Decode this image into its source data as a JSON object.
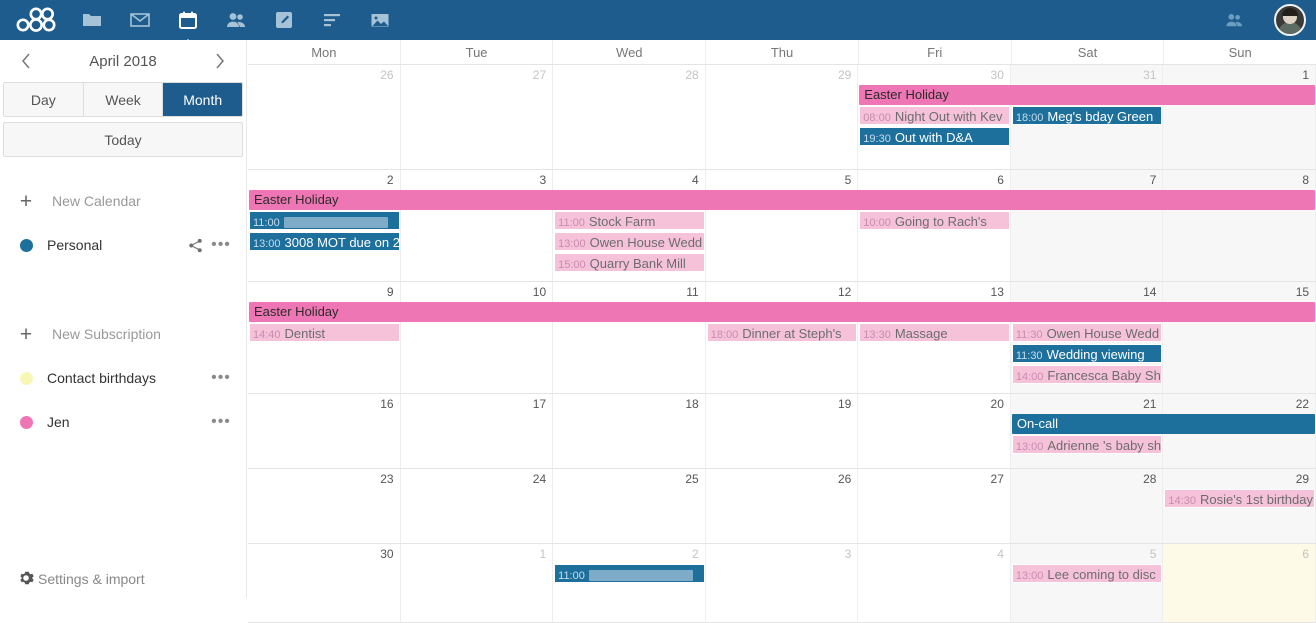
{
  "app": {
    "accent_blue": "#1d5c8c",
    "event_blue": "#1d6f9c",
    "event_pink": "#f5c2da",
    "holiday_pink": "#ee76b4"
  },
  "topbar": {
    "logo_name": "nextcloud-logo",
    "nav": [
      {
        "name": "files-icon",
        "label": "Files"
      },
      {
        "name": "mail-icon",
        "label": "Mail"
      },
      {
        "name": "calendar-icon",
        "label": "Calendar",
        "active": true
      },
      {
        "name": "contacts-icon",
        "label": "Contacts"
      },
      {
        "name": "notes-icon",
        "label": "Notes"
      },
      {
        "name": "tasks-icon",
        "label": "Tasks"
      },
      {
        "name": "photos-icon",
        "label": "Photos"
      }
    ],
    "right": [
      {
        "name": "contacts-menu-icon",
        "label": "Contacts"
      },
      {
        "name": "user-avatar",
        "label": "Account"
      }
    ]
  },
  "sidebar": {
    "month_label": "April 2018",
    "prev_label": "‹",
    "next_label": "›",
    "views": [
      {
        "label": "Day",
        "active": false
      },
      {
        "label": "Week",
        "active": false
      },
      {
        "label": "Month",
        "active": true
      }
    ],
    "today_label": "Today",
    "new_calendar_label": "New Calendar",
    "new_subscription_label": "New Subscription",
    "plus_glyph": "+",
    "dots_glyph": "•••",
    "calendars": [
      {
        "label": "Personal",
        "color": "#1d6f9c",
        "has_share": true,
        "has_menu": true
      },
      {
        "label": "Contact birthdays",
        "color": "#f7f7b6",
        "has_share": false,
        "has_menu": true
      },
      {
        "label": "Jen",
        "color": "#ee76b4",
        "has_share": false,
        "has_menu": true
      }
    ],
    "settings_label": "Settings & import"
  },
  "calendar": {
    "daynames": [
      "Mon",
      "Tue",
      "Wed",
      "Thu",
      "Fri",
      "Sat",
      "Sun"
    ],
    "weeks": [
      {
        "days": [
          {
            "num": "26",
            "other": true,
            "weekend": false
          },
          {
            "num": "27",
            "other": true,
            "weekend": false
          },
          {
            "num": "28",
            "other": true,
            "weekend": false
          },
          {
            "num": "29",
            "other": true,
            "weekend": false
          },
          {
            "num": "30",
            "other": true,
            "weekend": false
          },
          {
            "num": "31",
            "other": true,
            "weekend": true
          },
          {
            "num": "1",
            "other": false,
            "weekend": true
          }
        ],
        "events": [
          {
            "title": "Easter Holiday",
            "time": "",
            "kind": "holiday",
            "start": 4,
            "span": 3,
            "row": 0
          },
          {
            "title": "Night Out with Kev",
            "time": "08:00",
            "kind": "pink",
            "start": 4,
            "span": 1,
            "row": 1
          },
          {
            "title": "Meg's bday Green",
            "time": "18:00",
            "kind": "blue",
            "start": 5,
            "span": 1,
            "row": 1
          },
          {
            "title": "Out with D&A",
            "time": "19:30",
            "kind": "blue",
            "start": 4,
            "span": 1,
            "row": 2
          }
        ]
      },
      {
        "days": [
          {
            "num": "2",
            "other": false,
            "weekend": false
          },
          {
            "num": "3",
            "other": false,
            "weekend": false
          },
          {
            "num": "4",
            "other": false,
            "weekend": false
          },
          {
            "num": "5",
            "other": false,
            "weekend": false
          },
          {
            "num": "6",
            "other": false,
            "weekend": false
          },
          {
            "num": "7",
            "other": false,
            "weekend": true
          },
          {
            "num": "8",
            "other": false,
            "weekend": true
          }
        ],
        "events": [
          {
            "title": "Easter Holiday",
            "time": "",
            "kind": "holiday",
            "start": 0,
            "span": 7,
            "row": 0
          },
          {
            "title": "",
            "time": "11:00",
            "kind": "blue",
            "start": 0,
            "span": 1,
            "row": 1,
            "redacted": true
          },
          {
            "title": "Stock Farm",
            "time": "11:00",
            "kind": "pink",
            "start": 2,
            "span": 1,
            "row": 1
          },
          {
            "title": "3008 MOT due on 2",
            "time": "13:00",
            "kind": "blue",
            "start": 0,
            "span": 1,
            "row": 2
          },
          {
            "title": "Owen House Wedd",
            "time": "13:00",
            "kind": "pink",
            "start": 2,
            "span": 1,
            "row": 2
          },
          {
            "title": "Going to Rach's",
            "time": "10:00",
            "kind": "pink",
            "start": 4,
            "span": 1,
            "row": 1
          },
          {
            "title": "Quarry Bank Mill",
            "time": "15:00",
            "kind": "pink",
            "start": 2,
            "span": 1,
            "row": 3
          }
        ]
      },
      {
        "days": [
          {
            "num": "9",
            "other": false,
            "weekend": false
          },
          {
            "num": "10",
            "other": false,
            "weekend": false
          },
          {
            "num": "11",
            "other": false,
            "weekend": false
          },
          {
            "num": "12",
            "other": false,
            "weekend": false
          },
          {
            "num": "13",
            "other": false,
            "weekend": false
          },
          {
            "num": "14",
            "other": false,
            "weekend": true
          },
          {
            "num": "15",
            "other": false,
            "weekend": true
          }
        ],
        "events": [
          {
            "title": "Easter Holiday",
            "time": "",
            "kind": "holiday",
            "start": 0,
            "span": 7,
            "row": 0
          },
          {
            "title": "Dentist",
            "time": "14:40",
            "kind": "pink",
            "start": 0,
            "span": 1,
            "row": 1
          },
          {
            "title": "Dinner at Steph's",
            "time": "18:00",
            "kind": "pink",
            "start": 3,
            "span": 1,
            "row": 1
          },
          {
            "title": "Massage",
            "time": "13:30",
            "kind": "pink",
            "start": 4,
            "span": 1,
            "row": 1
          },
          {
            "title": "Owen House Wedd",
            "time": "11:30",
            "kind": "pink",
            "start": 5,
            "span": 1,
            "row": 1
          },
          {
            "title": "Wedding viewing",
            "time": "11:30",
            "kind": "blue",
            "start": 5,
            "span": 1,
            "row": 2
          },
          {
            "title": "Francesca Baby Sh",
            "time": "14:00",
            "kind": "pink",
            "start": 5,
            "span": 1,
            "row": 3
          }
        ]
      },
      {
        "days": [
          {
            "num": "16",
            "other": false,
            "weekend": false
          },
          {
            "num": "17",
            "other": false,
            "weekend": false
          },
          {
            "num": "18",
            "other": false,
            "weekend": false
          },
          {
            "num": "19",
            "other": false,
            "weekend": false
          },
          {
            "num": "20",
            "other": false,
            "weekend": false
          },
          {
            "num": "21",
            "other": false,
            "weekend": true
          },
          {
            "num": "22",
            "other": false,
            "weekend": true
          }
        ],
        "events": [
          {
            "title": "On-call",
            "time": "",
            "kind": "oncall",
            "start": 5,
            "span": 2,
            "row": 0
          },
          {
            "title": "Adrienne 's baby sh",
            "time": "13:00",
            "kind": "pink",
            "start": 5,
            "span": 1,
            "row": 1
          }
        ]
      },
      {
        "days": [
          {
            "num": "23",
            "other": false,
            "weekend": false
          },
          {
            "num": "24",
            "other": false,
            "weekend": false
          },
          {
            "num": "25",
            "other": false,
            "weekend": false
          },
          {
            "num": "26",
            "other": false,
            "weekend": false
          },
          {
            "num": "27",
            "other": false,
            "weekend": false
          },
          {
            "num": "28",
            "other": false,
            "weekend": true
          },
          {
            "num": "29",
            "other": false,
            "weekend": true
          }
        ],
        "events": [
          {
            "title": "Rosie's 1st birthday",
            "time": "14:30",
            "kind": "pink",
            "start": 6,
            "span": 1,
            "row": 0
          }
        ]
      },
      {
        "days": [
          {
            "num": "30",
            "other": false,
            "weekend": false
          },
          {
            "num": "1",
            "other": true,
            "weekend": false
          },
          {
            "num": "2",
            "other": true,
            "weekend": false
          },
          {
            "num": "3",
            "other": true,
            "weekend": false
          },
          {
            "num": "4",
            "other": true,
            "weekend": false
          },
          {
            "num": "5",
            "other": true,
            "weekend": true
          },
          {
            "num": "6",
            "other": true,
            "weekend": true,
            "nextmonth": true
          }
        ],
        "events": [
          {
            "title": "",
            "time": "11:00",
            "kind": "blue",
            "start": 2,
            "span": 1,
            "row": 0,
            "redacted": true
          },
          {
            "title": "Lee coming to disc",
            "time": "13:00",
            "kind": "pink",
            "start": 5,
            "span": 1,
            "row": 0
          }
        ]
      }
    ]
  }
}
